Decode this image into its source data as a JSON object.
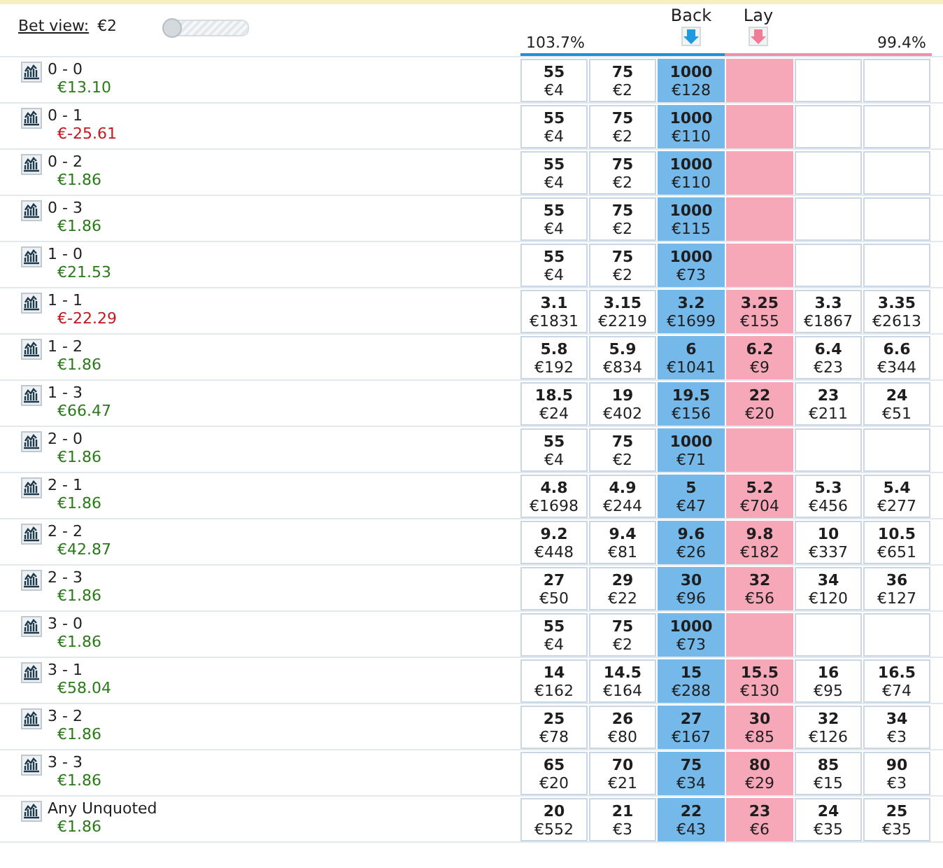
{
  "bet_view": {
    "label": "Bet view:",
    "stake": "€2",
    "slider": {
      "level": 0
    }
  },
  "back_header": {
    "label": "Back",
    "book": "103.7%"
  },
  "lay_header": {
    "label": "Lay",
    "book": "99.4%"
  },
  "rows": [
    {
      "name": "0 - 0",
      "profit": "€13.10",
      "negative": false,
      "back": [
        {
          "odds": "55",
          "amount": "€4"
        },
        {
          "odds": "75",
          "amount": "€2"
        },
        {
          "odds": "1000",
          "amount": "€128"
        }
      ],
      "lay": []
    },
    {
      "name": "0 - 1",
      "profit": "€-25.61",
      "negative": true,
      "back": [
        {
          "odds": "55",
          "amount": "€4"
        },
        {
          "odds": "75",
          "amount": "€2"
        },
        {
          "odds": "1000",
          "amount": "€110"
        }
      ],
      "lay": []
    },
    {
      "name": "0 - 2",
      "profit": "€1.86",
      "negative": false,
      "back": [
        {
          "odds": "55",
          "amount": "€4"
        },
        {
          "odds": "75",
          "amount": "€2"
        },
        {
          "odds": "1000",
          "amount": "€110"
        }
      ],
      "lay": []
    },
    {
      "name": "0 - 3",
      "profit": "€1.86",
      "negative": false,
      "back": [
        {
          "odds": "55",
          "amount": "€4"
        },
        {
          "odds": "75",
          "amount": "€2"
        },
        {
          "odds": "1000",
          "amount": "€115"
        }
      ],
      "lay": []
    },
    {
      "name": "1 - 0",
      "profit": "€21.53",
      "negative": false,
      "back": [
        {
          "odds": "55",
          "amount": "€4"
        },
        {
          "odds": "75",
          "amount": "€2"
        },
        {
          "odds": "1000",
          "amount": "€73"
        }
      ],
      "lay": []
    },
    {
      "name": "1 - 1",
      "profit": "€-22.29",
      "negative": true,
      "back": [
        {
          "odds": "3.1",
          "amount": "€1831"
        },
        {
          "odds": "3.15",
          "amount": "€2219"
        },
        {
          "odds": "3.2",
          "amount": "€1699"
        }
      ],
      "lay": [
        {
          "odds": "3.25",
          "amount": "€155"
        },
        {
          "odds": "3.3",
          "amount": "€1867"
        },
        {
          "odds": "3.35",
          "amount": "€2613"
        }
      ]
    },
    {
      "name": "1 - 2",
      "profit": "€1.86",
      "negative": false,
      "back": [
        {
          "odds": "5.8",
          "amount": "€192"
        },
        {
          "odds": "5.9",
          "amount": "€834"
        },
        {
          "odds": "6",
          "amount": "€1041"
        }
      ],
      "lay": [
        {
          "odds": "6.2",
          "amount": "€9"
        },
        {
          "odds": "6.4",
          "amount": "€23"
        },
        {
          "odds": "6.6",
          "amount": "€344"
        }
      ]
    },
    {
      "name": "1 - 3",
      "profit": "€66.47",
      "negative": false,
      "back": [
        {
          "odds": "18.5",
          "amount": "€24"
        },
        {
          "odds": "19",
          "amount": "€402"
        },
        {
          "odds": "19.5",
          "amount": "€156"
        }
      ],
      "lay": [
        {
          "odds": "22",
          "amount": "€20"
        },
        {
          "odds": "23",
          "amount": "€211"
        },
        {
          "odds": "24",
          "amount": "€51"
        }
      ]
    },
    {
      "name": "2 - 0",
      "profit": "€1.86",
      "negative": false,
      "back": [
        {
          "odds": "55",
          "amount": "€4"
        },
        {
          "odds": "75",
          "amount": "€2"
        },
        {
          "odds": "1000",
          "amount": "€71"
        }
      ],
      "lay": []
    },
    {
      "name": "2 - 1",
      "profit": "€1.86",
      "negative": false,
      "back": [
        {
          "odds": "4.8",
          "amount": "€1698"
        },
        {
          "odds": "4.9",
          "amount": "€244"
        },
        {
          "odds": "5",
          "amount": "€47"
        }
      ],
      "lay": [
        {
          "odds": "5.2",
          "amount": "€704"
        },
        {
          "odds": "5.3",
          "amount": "€456"
        },
        {
          "odds": "5.4",
          "amount": "€277"
        }
      ]
    },
    {
      "name": "2 - 2",
      "profit": "€42.87",
      "negative": false,
      "back": [
        {
          "odds": "9.2",
          "amount": "€448"
        },
        {
          "odds": "9.4",
          "amount": "€81"
        },
        {
          "odds": "9.6",
          "amount": "€26"
        }
      ],
      "lay": [
        {
          "odds": "9.8",
          "amount": "€182"
        },
        {
          "odds": "10",
          "amount": "€337"
        },
        {
          "odds": "10.5",
          "amount": "€651"
        }
      ]
    },
    {
      "name": "2 - 3",
      "profit": "€1.86",
      "negative": false,
      "back": [
        {
          "odds": "27",
          "amount": "€50"
        },
        {
          "odds": "29",
          "amount": "€22"
        },
        {
          "odds": "30",
          "amount": "€96"
        }
      ],
      "lay": [
        {
          "odds": "32",
          "amount": "€56"
        },
        {
          "odds": "34",
          "amount": "€120"
        },
        {
          "odds": "36",
          "amount": "€127"
        }
      ]
    },
    {
      "name": "3 - 0",
      "profit": "€1.86",
      "negative": false,
      "back": [
        {
          "odds": "55",
          "amount": "€4"
        },
        {
          "odds": "75",
          "amount": "€2"
        },
        {
          "odds": "1000",
          "amount": "€73"
        }
      ],
      "lay": []
    },
    {
      "name": "3 - 1",
      "profit": "€58.04",
      "negative": false,
      "back": [
        {
          "odds": "14",
          "amount": "€162"
        },
        {
          "odds": "14.5",
          "amount": "€164"
        },
        {
          "odds": "15",
          "amount": "€288"
        }
      ],
      "lay": [
        {
          "odds": "15.5",
          "amount": "€130"
        },
        {
          "odds": "16",
          "amount": "€95"
        },
        {
          "odds": "16.5",
          "amount": "€74"
        }
      ]
    },
    {
      "name": "3 - 2",
      "profit": "€1.86",
      "negative": false,
      "back": [
        {
          "odds": "25",
          "amount": "€78"
        },
        {
          "odds": "26",
          "amount": "€80"
        },
        {
          "odds": "27",
          "amount": "€167"
        }
      ],
      "lay": [
        {
          "odds": "30",
          "amount": "€85"
        },
        {
          "odds": "32",
          "amount": "€126"
        },
        {
          "odds": "34",
          "amount": "€3"
        }
      ]
    },
    {
      "name": "3 - 3",
      "profit": "€1.86",
      "negative": false,
      "back": [
        {
          "odds": "65",
          "amount": "€20"
        },
        {
          "odds": "70",
          "amount": "€21"
        },
        {
          "odds": "75",
          "amount": "€34"
        }
      ],
      "lay": [
        {
          "odds": "80",
          "amount": "€29"
        },
        {
          "odds": "85",
          "amount": "€15"
        },
        {
          "odds": "90",
          "amount": "€3"
        }
      ]
    },
    {
      "name": "Any Unquoted",
      "profit": "€1.86",
      "negative": false,
      "back": [
        {
          "odds": "20",
          "amount": "€552"
        },
        {
          "odds": "21",
          "amount": "€3"
        },
        {
          "odds": "22",
          "amount": "€43"
        }
      ],
      "lay": [
        {
          "odds": "23",
          "amount": "€6"
        },
        {
          "odds": "24",
          "amount": "€35"
        },
        {
          "odds": "25",
          "amount": "€35"
        }
      ]
    }
  ]
}
